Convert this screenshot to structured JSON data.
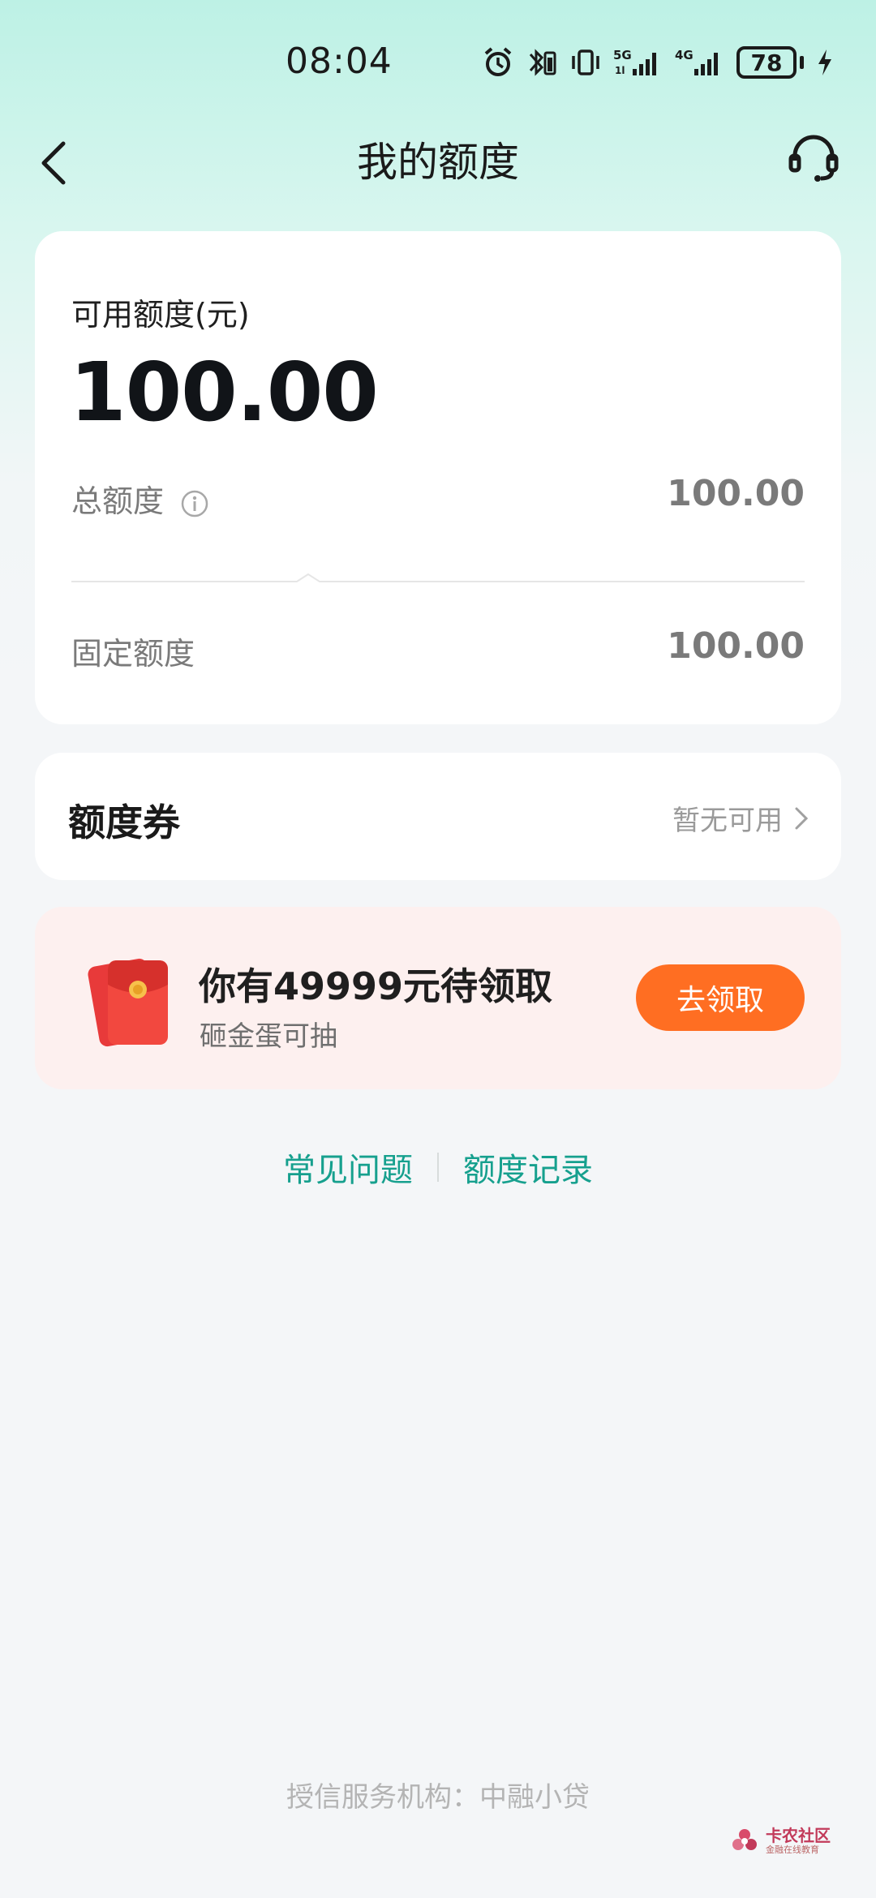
{
  "status_bar": {
    "time": "08:04",
    "battery": "78"
  },
  "nav": {
    "title": "我的额度"
  },
  "quota": {
    "available_label": "可用额度(元)",
    "available_amount": "100.00",
    "total_label": "总额度",
    "total_value": "100.00",
    "fixed_label": "固定额度",
    "fixed_value": "100.00"
  },
  "coupon": {
    "title": "额度券",
    "status": "暂无可用"
  },
  "promo": {
    "title": "你有49999元待领取",
    "subtitle": "砸金蛋可抽",
    "button": "去领取"
  },
  "links": {
    "faq": "常见问题",
    "records": "额度记录"
  },
  "footer": {
    "text": "授信服务机构：中融小贷"
  },
  "watermark": {
    "main": "卡农社区",
    "sub": "金融在线教育"
  },
  "colors": {
    "accent": "#16a08e",
    "button": "#ff6e22",
    "promo_bg": "#fdf0ef"
  }
}
